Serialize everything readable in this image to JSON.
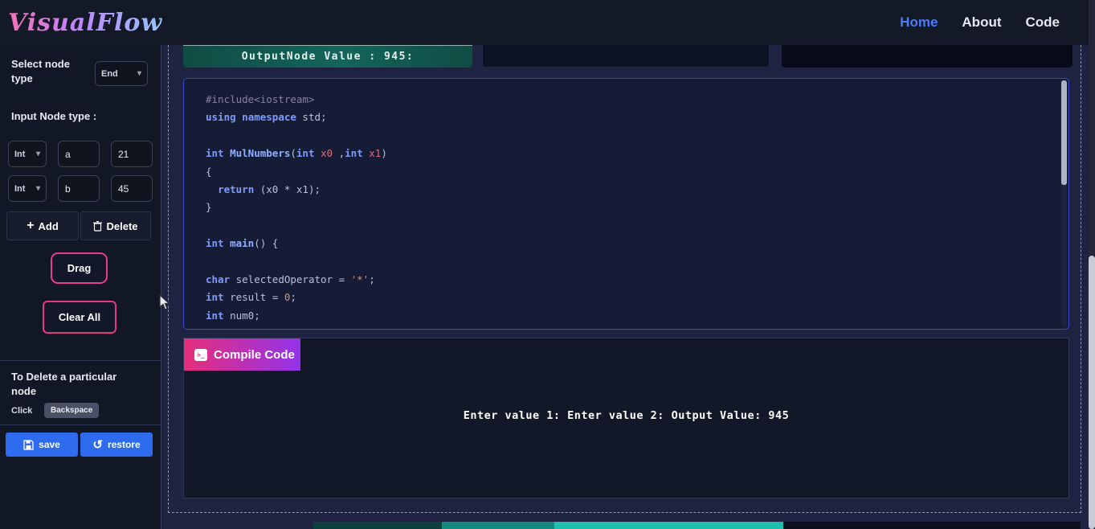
{
  "navbar": {
    "brand": "VisualFlow",
    "links": [
      {
        "label": "Home"
      },
      {
        "label": "About"
      },
      {
        "label": "Code"
      }
    ]
  },
  "sidebar": {
    "select_node_label": "Select node type",
    "node_type_value": "End",
    "input_node_label": "Input Node type :",
    "input_rows": [
      {
        "type": "Int",
        "name": "a",
        "value": "21"
      },
      {
        "type": "Int",
        "name": "b",
        "value": "45"
      }
    ],
    "add_label": "Add",
    "delete_label": "Delete",
    "drag_label": "Drag",
    "clear_all_label": "Clear All",
    "delete_hint_title": "To Delete a particular node",
    "delete_hint_click": "Click",
    "delete_hint_key": "Backspace",
    "save_label": "save",
    "restore_label": "restore"
  },
  "icons": {
    "plus": "+",
    "chevron": "▾",
    "restore": "↺",
    "terminal": ">_"
  },
  "canvas": {
    "output_node_text": "OutputNode Value : 945:"
  },
  "code": {
    "lines": [
      [
        {
          "c": "inc",
          "t": "#include<iostream>"
        }
      ],
      [
        {
          "c": "kw",
          "t": "using"
        },
        {
          "c": "pl",
          "t": " "
        },
        {
          "c": "kw",
          "t": "namespace"
        },
        {
          "c": "pl",
          "t": " std;"
        }
      ],
      [],
      [
        {
          "c": "kw",
          "t": "int"
        },
        {
          "c": "pl",
          "t": " "
        },
        {
          "c": "fn",
          "t": "MulNumbers"
        },
        {
          "c": "pl",
          "t": "("
        },
        {
          "c": "kw",
          "t": "int"
        },
        {
          "c": "pl",
          "t": " "
        },
        {
          "c": "var",
          "t": "x0"
        },
        {
          "c": "pl",
          "t": " ,"
        },
        {
          "c": "kw",
          "t": "int"
        },
        {
          "c": "pl",
          "t": " "
        },
        {
          "c": "var",
          "t": "x1"
        },
        {
          "c": "pl",
          "t": ")"
        }
      ],
      [
        {
          "c": "pl",
          "t": "{"
        }
      ],
      [
        {
          "c": "pl",
          "t": "  "
        },
        {
          "c": "kw",
          "t": "return"
        },
        {
          "c": "pl",
          "t": " (x0 * x1);"
        }
      ],
      [
        {
          "c": "pl",
          "t": "}"
        }
      ],
      [],
      [
        {
          "c": "kw",
          "t": "int"
        },
        {
          "c": "pl",
          "t": " "
        },
        {
          "c": "fn",
          "t": "main"
        },
        {
          "c": "pl",
          "t": "() {"
        }
      ],
      [],
      [
        {
          "c": "kw",
          "t": "char"
        },
        {
          "c": "pl",
          "t": " selectedOperator = "
        },
        {
          "c": "str",
          "t": "'*'"
        },
        {
          "c": "pl",
          "t": ";"
        }
      ],
      [
        {
          "c": "kw",
          "t": "int"
        },
        {
          "c": "pl",
          "t": " result = "
        },
        {
          "c": "num",
          "t": "0"
        },
        {
          "c": "pl",
          "t": ";"
        }
      ],
      [
        {
          "c": "kw",
          "t": "int"
        },
        {
          "c": "pl",
          "t": " num0;"
        }
      ]
    ]
  },
  "compile": {
    "button_label": "Compile Code",
    "output_text": "Enter value 1: Enter value 2: Output Value: 945"
  }
}
